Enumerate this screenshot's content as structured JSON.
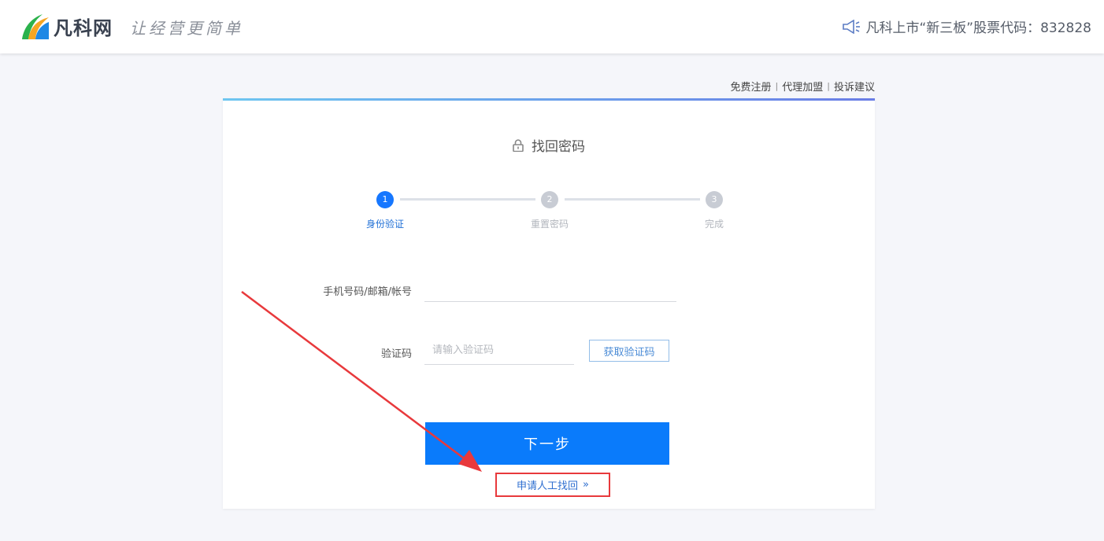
{
  "header": {
    "brand": "凡科网",
    "slogan": "让经营更简单",
    "notice": "凡科上市“新三板”股票代码：832828",
    "notice_icon": "speaker-icon"
  },
  "top_links": [
    {
      "label": "免费注册"
    },
    {
      "label": "代理加盟"
    },
    {
      "label": "投诉建议"
    }
  ],
  "top_links_separator": "|",
  "card": {
    "title": "找回密码",
    "title_icon": "lock-icon",
    "steps": [
      {
        "number": "1",
        "label": "身份验证",
        "active": true
      },
      {
        "number": "2",
        "label": "重置密码",
        "active": false
      },
      {
        "number": "3",
        "label": "完成",
        "active": false
      }
    ],
    "account_label": "手机号码/邮箱/帐号",
    "account_value": "",
    "code_label": "验证码",
    "code_placeholder": "请输入验证码",
    "get_code_button": "获取验证码",
    "next_button": "下一步",
    "manual_link": "申请人工找回",
    "manual_link_chevron": "»"
  },
  "colors": {
    "primary": "#0a7bfb",
    "active_step": "#1677ff",
    "inactive_step": "#c8ccd4",
    "highlight_box": "#e8393c",
    "annotation_arrow": "#e8393c"
  }
}
